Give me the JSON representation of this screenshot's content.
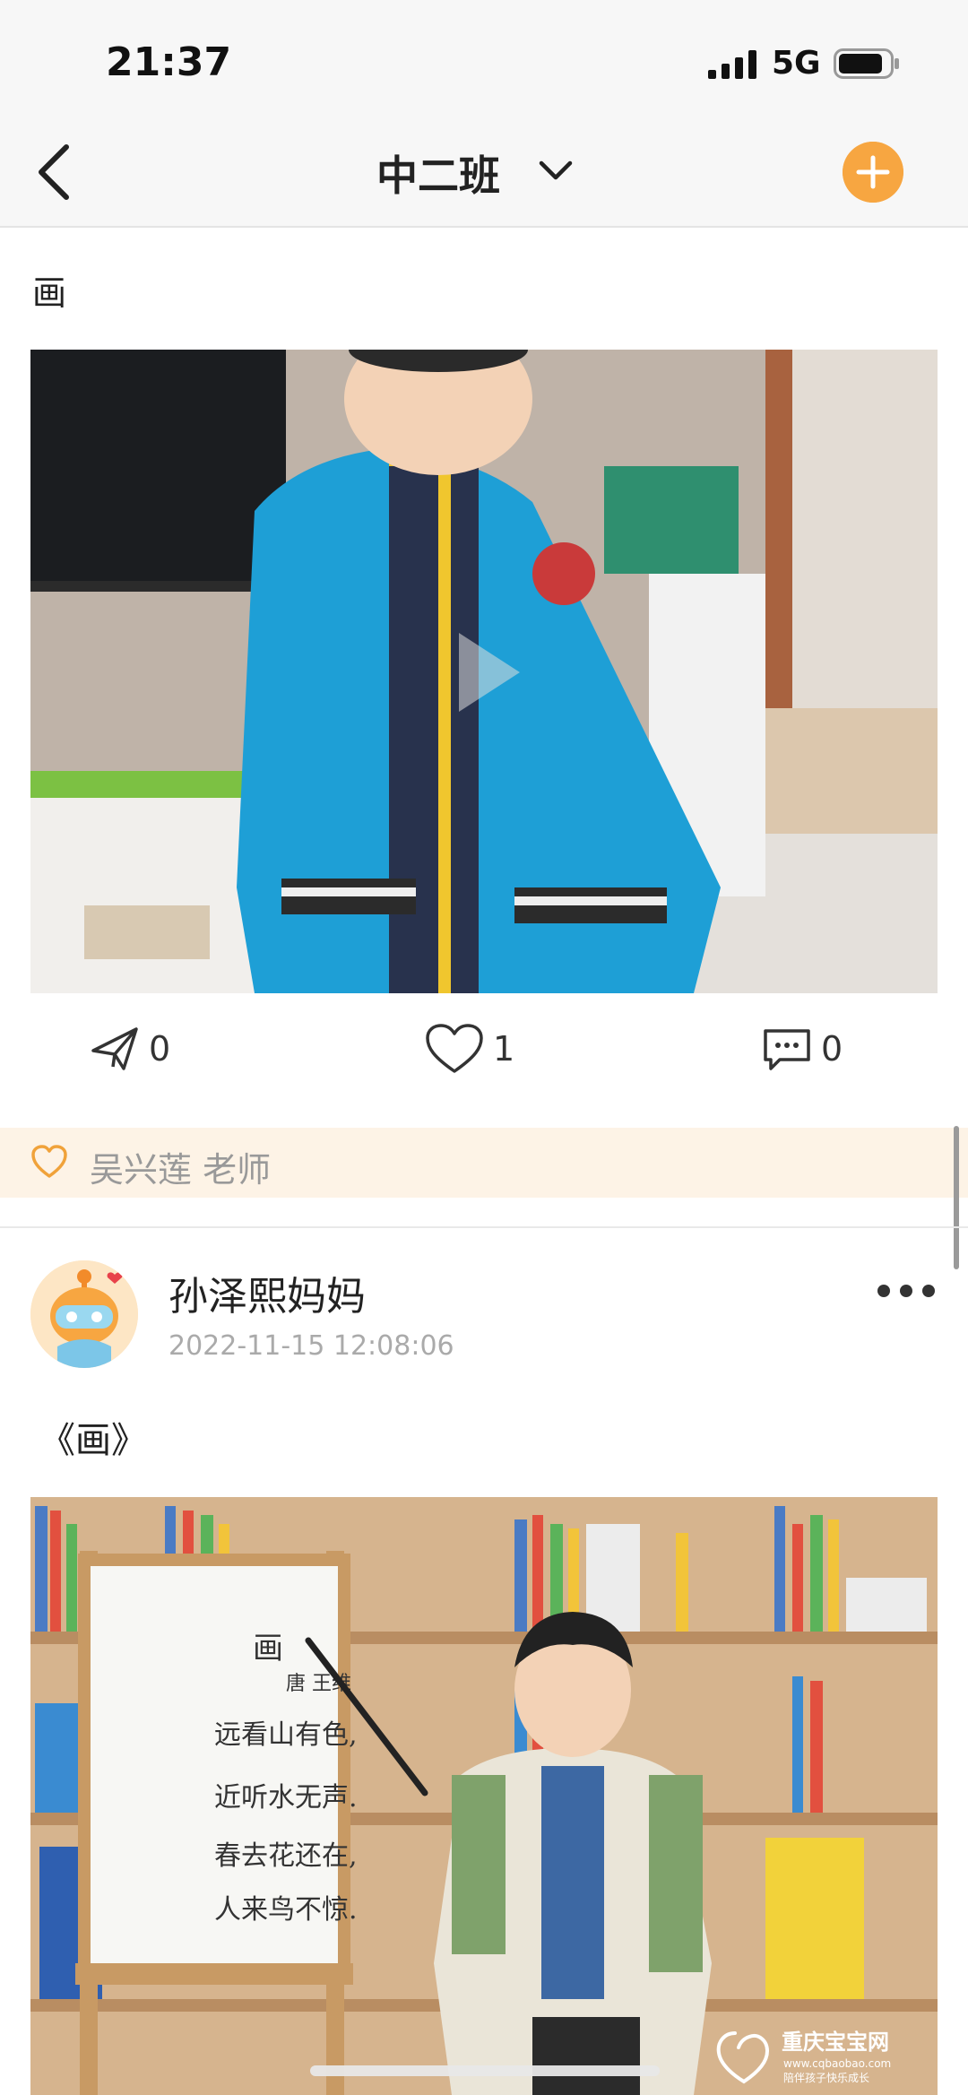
{
  "status_bar": {
    "time": "21:37",
    "network": "5G",
    "signal_icon": "signal-bars-icon",
    "battery_icon": "battery-icon"
  },
  "nav": {
    "title": "中二班",
    "back_icon": "chevron-left-icon",
    "dropdown_icon": "chevron-down-icon",
    "add_icon": "plus-icon",
    "accent_color": "#f7a641"
  },
  "post1": {
    "text": "画",
    "media": "video-thumbnail",
    "actions": {
      "share_count": "0",
      "like_count": "1",
      "comment_count": "0"
    },
    "likes": {
      "names": "吴兴莲 老师"
    }
  },
  "post2": {
    "author": "孙泽熙妈妈",
    "time": "2022-11-15 12:08:06",
    "text": "《画》",
    "media": "photo",
    "poem": {
      "title": "画",
      "author": "唐 王维",
      "lines": [
        "远看山有色,",
        "近听水无声.",
        "春去花还在,",
        "人来鸟不惊."
      ]
    }
  },
  "watermark": {
    "brand": "重庆宝宝网",
    "url": "www.cqbaobao.com",
    "slogan": "陪伴孩子快乐成长"
  },
  "colors": {
    "likes_bg": "#fdf3e6",
    "accent": "#f7a641"
  }
}
